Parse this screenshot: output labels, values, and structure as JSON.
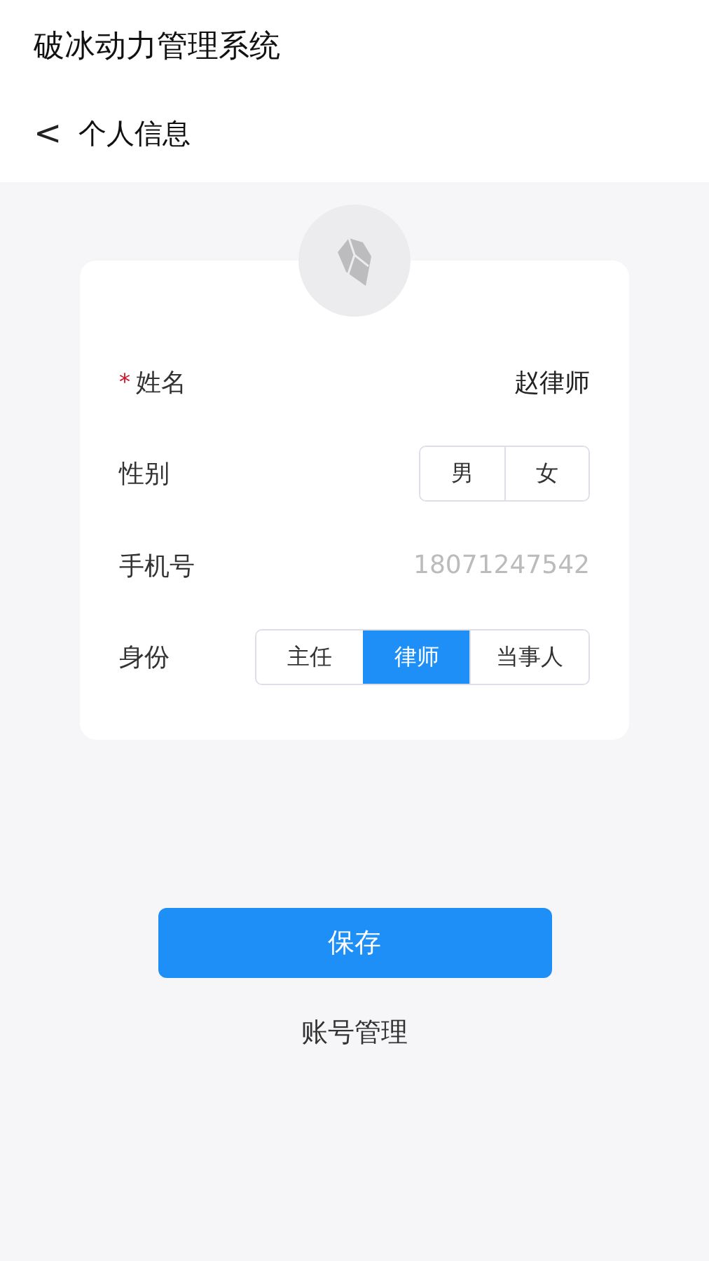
{
  "app_title": "破冰动力管理系统",
  "nav": {
    "back": "<",
    "title": "个人信息"
  },
  "fields": [
    {
      "kind": "input",
      "required_mark": "*",
      "label": "姓名",
      "value": "赵律师"
    },
    {
      "kind": "choice",
      "label": "性别",
      "options": [
        {
          "label": "男",
          "selected": false
        },
        {
          "label": "女",
          "selected": false
        }
      ]
    },
    {
      "kind": "readonly",
      "label": "手机号",
      "value": "18071247542"
    },
    {
      "kind": "choice",
      "label": "身份",
      "options": [
        {
          "label": "主任",
          "selected": false
        },
        {
          "label": "律师",
          "selected": true
        },
        {
          "label": "当事人",
          "selected": false
        }
      ]
    }
  ],
  "save_button": "保存",
  "account_link": "账号管理"
}
